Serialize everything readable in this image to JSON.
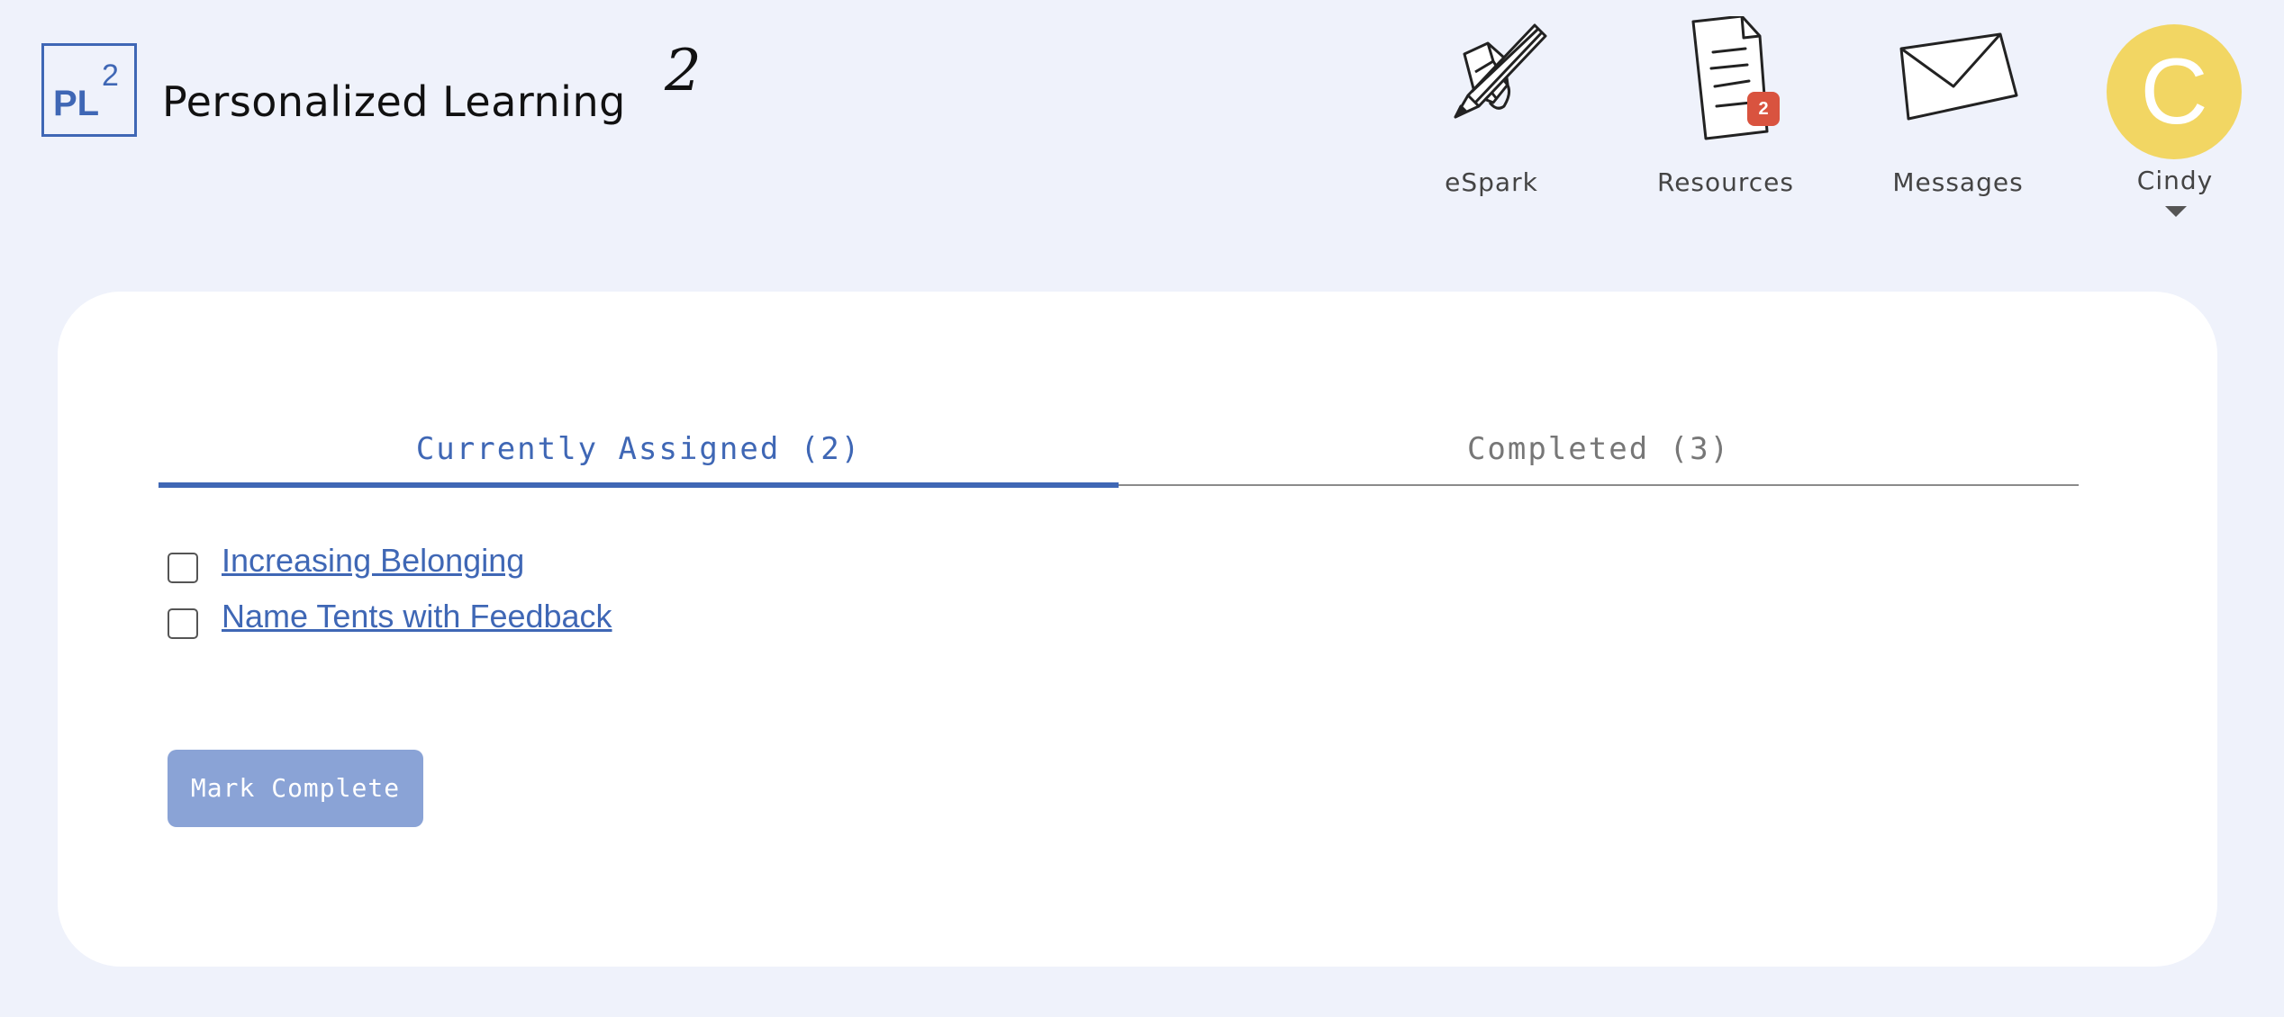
{
  "header": {
    "logo_text": "PL",
    "logo_sup": "2",
    "app_title": "Personalized Learning",
    "app_title_sup": "2"
  },
  "nav": {
    "espark": {
      "label": "eSpark",
      "icon": "pencil-eraser-icon"
    },
    "resources": {
      "label": "Resources",
      "icon": "document-icon",
      "badge": "2"
    },
    "messages": {
      "label": "Messages",
      "icon": "envelope-icon"
    }
  },
  "user": {
    "initial": "C",
    "name": "Cindy",
    "avatar_color": "#f2d663"
  },
  "tabs": [
    {
      "label": "Currently Assigned (2)",
      "active": true
    },
    {
      "label": "Completed (3)",
      "active": false
    }
  ],
  "tasks": [
    {
      "title": "Increasing Belonging",
      "checked": false
    },
    {
      "title": "Name Tents with Feedback",
      "checked": false
    }
  ],
  "actions": {
    "mark_complete": "Mark Complete"
  },
  "colors": {
    "accent": "#3f67b5",
    "button": "#8aa3d6",
    "badge": "#d9533f",
    "background": "#eff2fb"
  }
}
